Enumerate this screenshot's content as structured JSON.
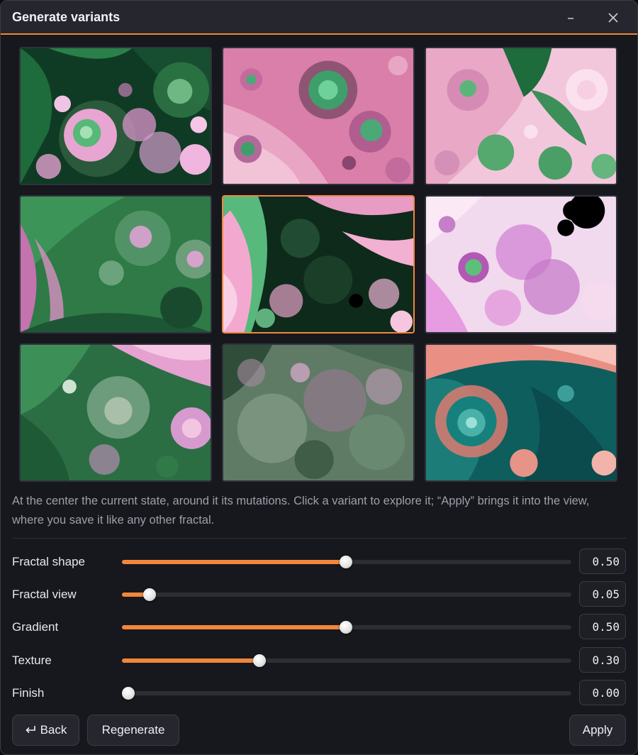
{
  "window": {
    "title": "Generate variants",
    "minimize_icon": "minimize-icon",
    "close_icon": "close-icon",
    "accent_color": "#f2873c"
  },
  "variants": {
    "selected_index": 4,
    "tiles": [
      {
        "palette": "green-pink"
      },
      {
        "palette": "pink-green"
      },
      {
        "palette": "pink-green-light"
      },
      {
        "palette": "green"
      },
      {
        "palette": "dark-green-pink"
      },
      {
        "palette": "lavender-magenta"
      },
      {
        "palette": "green-pink-spiral"
      },
      {
        "palette": "muted-green-pink"
      },
      {
        "palette": "teal-salmon"
      }
    ]
  },
  "description": "At the center the current state, around it its mutations. Click a variant to explore it; “Apply” brings it into the view, where you save it like any other fractal.",
  "sliders": [
    {
      "label": "Fractal shape",
      "value": 0.5,
      "display": "0.50"
    },
    {
      "label": "Fractal view",
      "value": 0.05,
      "display": "0.05"
    },
    {
      "label": "Gradient",
      "value": 0.5,
      "display": "0.50"
    },
    {
      "label": "Texture",
      "value": 0.3,
      "display": "0.30"
    },
    {
      "label": "Finish",
      "value": 0.0,
      "display": "0.00"
    }
  ],
  "buttons": {
    "back_label": "Back",
    "back_icon": "return-arrow-icon",
    "regenerate_label": "Regenerate",
    "apply_label": "Apply"
  }
}
